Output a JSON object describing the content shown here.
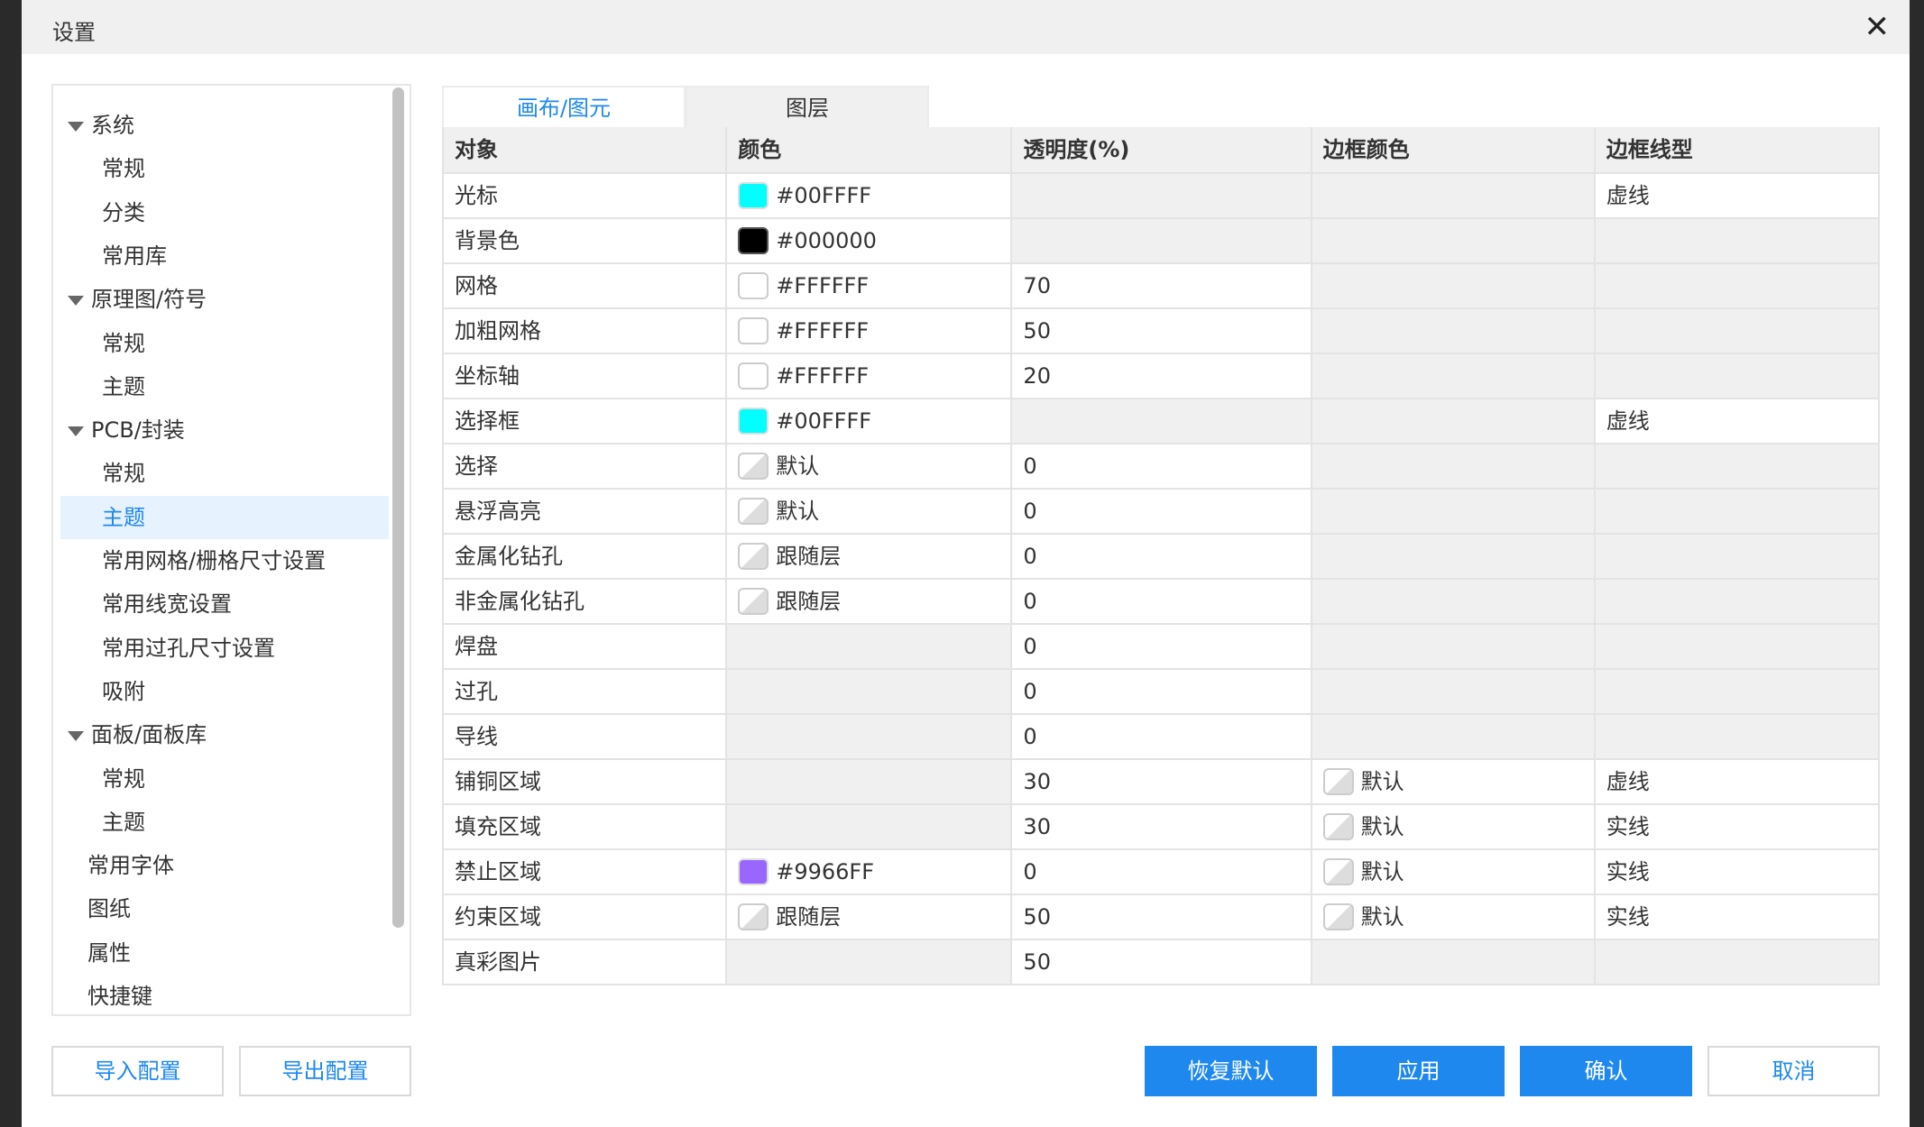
{
  "dialog": {
    "title": "设置",
    "close_icon": "close-icon"
  },
  "tree": [
    {
      "label": "系统",
      "level": 0,
      "expanded": true
    },
    {
      "label": "常规",
      "level": 1
    },
    {
      "label": "分类",
      "level": 1
    },
    {
      "label": "常用库",
      "level": 1
    },
    {
      "label": "原理图/符号",
      "level": 0,
      "expanded": true
    },
    {
      "label": "常规",
      "level": 1
    },
    {
      "label": "主题",
      "level": 1
    },
    {
      "label": "PCB/封装",
      "level": 0,
      "expanded": true
    },
    {
      "label": "常规",
      "level": 1
    },
    {
      "label": "主题",
      "level": 1,
      "selected": true
    },
    {
      "label": "常用网格/栅格尺寸设置",
      "level": 1
    },
    {
      "label": "常用线宽设置",
      "level": 1
    },
    {
      "label": "常用过孔尺寸设置",
      "level": 1
    },
    {
      "label": "吸附",
      "level": 1
    },
    {
      "label": "面板/面板库",
      "level": 0,
      "expanded": true
    },
    {
      "label": "常规",
      "level": 1
    },
    {
      "label": "主题",
      "level": 1
    },
    {
      "label": "常用字体",
      "level": 0
    },
    {
      "label": "图纸",
      "level": 0
    },
    {
      "label": "属性",
      "level": 0
    },
    {
      "label": "快捷键",
      "level": 0
    }
  ],
  "tabs": [
    {
      "label": "画布/图元",
      "active": true
    },
    {
      "label": "图层",
      "active": false
    }
  ],
  "table": {
    "headers": [
      "对象",
      "颜色",
      "透明度(%)",
      "边框颜色",
      "边框线型"
    ],
    "rows": [
      {
        "object": "光标",
        "color": {
          "swatch": "#00FFFF",
          "text": "#00FFFF"
        },
        "opacity": "",
        "border_color": null,
        "line": "虚线"
      },
      {
        "object": "背景色",
        "color": {
          "swatch": "#000000",
          "text": "#000000"
        },
        "opacity": "",
        "border_color": null,
        "line": ""
      },
      {
        "object": "网格",
        "color": {
          "swatch": "#FFFFFF",
          "text": "#FFFFFF"
        },
        "opacity": "70",
        "border_color": null,
        "line": ""
      },
      {
        "object": "加粗网格",
        "color": {
          "swatch": "#FFFFFF",
          "text": "#FFFFFF"
        },
        "opacity": "50",
        "border_color": null,
        "line": ""
      },
      {
        "object": "坐标轴",
        "color": {
          "swatch": "#FFFFFF",
          "text": "#FFFFFF"
        },
        "opacity": "20",
        "border_color": null,
        "line": ""
      },
      {
        "object": "选择框",
        "color": {
          "swatch": "#00FFFF",
          "text": "#00FFFF"
        },
        "opacity": "",
        "border_color": null,
        "line": "虚线"
      },
      {
        "object": "选择",
        "color": {
          "swatch": "default",
          "text": "默认"
        },
        "opacity": "0",
        "border_color": null,
        "line": ""
      },
      {
        "object": "悬浮高亮",
        "color": {
          "swatch": "default",
          "text": "默认"
        },
        "opacity": "0",
        "border_color": null,
        "line": ""
      },
      {
        "object": "金属化钻孔",
        "color": {
          "swatch": "default",
          "text": "跟随层"
        },
        "opacity": "0",
        "border_color": null,
        "line": ""
      },
      {
        "object": "非金属化钻孔",
        "color": {
          "swatch": "default",
          "text": "跟随层"
        },
        "opacity": "0",
        "border_color": null,
        "line": ""
      },
      {
        "object": "焊盘",
        "color": null,
        "opacity": "0",
        "border_color": null,
        "line": ""
      },
      {
        "object": "过孔",
        "color": null,
        "opacity": "0",
        "border_color": null,
        "line": ""
      },
      {
        "object": "导线",
        "color": null,
        "opacity": "0",
        "border_color": null,
        "line": ""
      },
      {
        "object": "铺铜区域",
        "color": null,
        "opacity": "30",
        "border_color": {
          "swatch": "default",
          "text": "默认"
        },
        "line": "虚线"
      },
      {
        "object": "填充区域",
        "color": null,
        "opacity": "30",
        "border_color": {
          "swatch": "default",
          "text": "默认"
        },
        "line": "实线"
      },
      {
        "object": "禁止区域",
        "color": {
          "swatch": "#9966FF",
          "text": "#9966FF"
        },
        "opacity": "0",
        "border_color": {
          "swatch": "default",
          "text": "默认"
        },
        "line": "实线"
      },
      {
        "object": "约束区域",
        "color": {
          "swatch": "default",
          "text": "跟随层"
        },
        "opacity": "50",
        "border_color": {
          "swatch": "default",
          "text": "默认"
        },
        "line": "实线"
      },
      {
        "object": "真彩图片",
        "color": null,
        "opacity": "50",
        "border_color": null,
        "line": ""
      }
    ]
  },
  "buttons": {
    "import": "导入配置",
    "export": "导出配置",
    "restore": "恢复默认",
    "apply": "应用",
    "ok": "确认",
    "cancel": "取消"
  },
  "accent": "#1E88EE"
}
